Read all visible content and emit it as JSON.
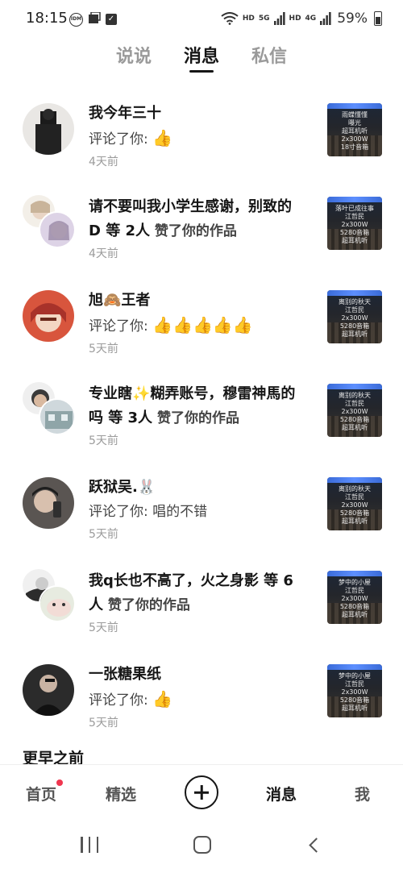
{
  "status_bar": {
    "time": "18:15",
    "left_icons": [
      "idm-icon",
      "gallery-icon",
      "check-icon"
    ],
    "network_1": "HD",
    "network_2": "5G",
    "network_3": "HD",
    "network_4": "4G",
    "battery_percent": "59%"
  },
  "tabs": [
    {
      "label": "说说",
      "active": false
    },
    {
      "label": "消息",
      "active": true
    },
    {
      "label": "私信",
      "active": false
    }
  ],
  "notifications": [
    {
      "name": "我今年三十",
      "action_prefix": "评论了你: ",
      "emoji": "👍",
      "time": "4天前",
      "thumb_caption": [
        "雨蝶懂懂",
        "曝光",
        "超耳机听",
        "2x300W",
        "18寸音箱"
      ]
    },
    {
      "name": "请不要叫我小学生感谢，别致的D 等 2人",
      "verb": " 赞了你的作品",
      "time": "4天前",
      "thumb_caption": [
        "落叶已成往事",
        "江哲民",
        "2x300W",
        "5280音箱",
        "超耳机听"
      ]
    },
    {
      "name": "旭🙈王者",
      "action_prefix": "评论了你: ",
      "emoji": "👍👍👍👍👍",
      "time": "5天前",
      "thumb_caption": [
        "离别的秋天",
        "江哲民",
        "2x300W",
        "5280音箱",
        "超耳机听"
      ]
    },
    {
      "name": "专业瞎✨糊弄账号，穆雷神馬的吗 等 3人",
      "verb": " 赞了你的作品",
      "time": "5天前",
      "thumb_caption": [
        "离别的秋天",
        "江哲民",
        "2x300W",
        "5280音箱",
        "超耳机听"
      ]
    },
    {
      "name": "跃狱吴.🐰",
      "action_prefix": "评论了你: ",
      "text": "唱的不错",
      "time": "5天前",
      "thumb_caption": [
        "离别的秋天",
        "江哲民",
        "2x300W",
        "5280音箱",
        "超耳机听"
      ]
    },
    {
      "name": "我q长也不高了，火之身影 等 6人",
      "verb": " 赞了你的作品",
      "time": "5天前",
      "thumb_caption": [
        "梦中的小屋",
        "江哲民",
        "2x300W",
        "5280音箱",
        "超耳机听"
      ]
    },
    {
      "name": "一张糖果纸",
      "action_prefix": "评论了你: ",
      "emoji": "👍",
      "time": "5天前",
      "thumb_caption": [
        "梦中的小屋",
        "江哲民",
        "2x300W",
        "5280音箱",
        "超耳机听"
      ]
    }
  ],
  "section_title": "更早之前",
  "bottom_nav": {
    "home": "首页",
    "featured": "精选",
    "messages": "消息",
    "me": "我",
    "home_has_dot": true
  },
  "colors": {
    "accent_dot": "#f0364f",
    "text_primary": "#161616",
    "text_muted": "#9b9b9b"
  }
}
